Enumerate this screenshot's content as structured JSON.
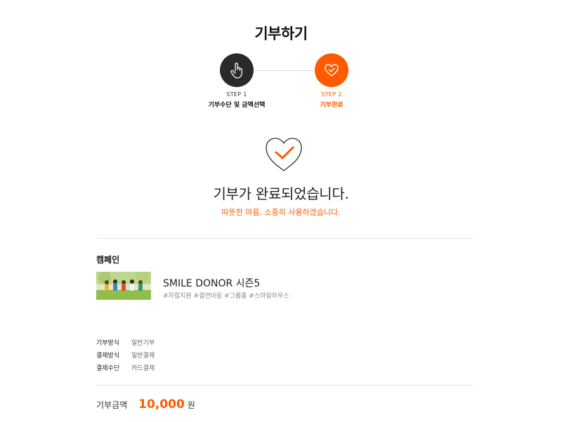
{
  "page": {
    "title": "기부하기"
  },
  "steps": [
    {
      "num": "STEP 1",
      "label": "기부수단 및 금액선택",
      "icon": "hand-pointer-icon",
      "color": "#2a2a2a"
    },
    {
      "num": "STEP 2",
      "label": "기부완료",
      "icon": "heart-check-icon",
      "color": "#ff5a00"
    }
  ],
  "completion": {
    "icon": "heart-check-icon",
    "message": "기부가 완료되었습니다.",
    "sub_message": "따뜻한 마음, 소중히 사용하겠습니다."
  },
  "campaign": {
    "heading": "캠페인",
    "name": "SMILE DONOR 시즌5",
    "tags": "#자립지원 #결연아동 #그룹홈 #스마일하우스"
  },
  "details": [
    {
      "key": "기부방식",
      "value": "일반기부"
    },
    {
      "key": "결제방식",
      "value": "일반결제"
    },
    {
      "key": "결제수단",
      "value": "카드결제"
    }
  ],
  "total": {
    "label": "기부금액",
    "amount": "10,000",
    "unit": "원"
  },
  "colors": {
    "accent": "#ff5a00",
    "dark": "#2a2a2a"
  }
}
